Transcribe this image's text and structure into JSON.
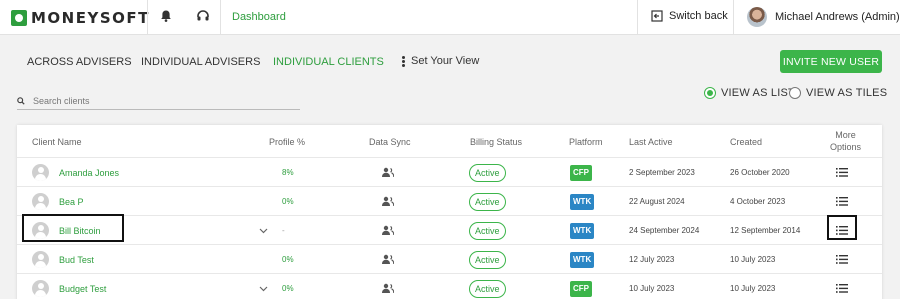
{
  "topbar": {
    "logo_text": "MONEYSOFT",
    "bell_icon": "bell-icon",
    "support_icon": "headset-icon",
    "dashboard_link": "Dashboard",
    "switch_back": "Switch back",
    "user_name": "Michael Andrews (Admin)"
  },
  "nav": {
    "items": [
      "ACROSS ADVISERS",
      "INDIVIDUAL ADVISERS",
      "INDIVIDUAL CLIENTS"
    ],
    "active": "INDIVIDUAL CLIENTS",
    "set_view": "Set Your View",
    "invite_button": "INVITE NEW USER"
  },
  "search": {
    "placeholder": "Search clients",
    "value": ""
  },
  "view": {
    "list_label": "VIEW AS LIST",
    "tiles_label": "VIEW AS TILES",
    "selected": "list"
  },
  "table": {
    "headers": {
      "client_name": "Client Name",
      "profile": "Profile %",
      "data_sync": "Data Sync",
      "billing": "Billing Status",
      "platform": "Platform",
      "last_active": "Last Active",
      "created": "Created",
      "more_line1": "More",
      "more_line2": "Options"
    },
    "rows": [
      {
        "name": "Amanda Jones",
        "profile": "8%",
        "billing": "Active",
        "platform": "CFP",
        "last_active": "2 September 2023",
        "created": "26 October 2020",
        "expand": false
      },
      {
        "name": "Bea P",
        "profile": "0%",
        "billing": "Active",
        "platform": "WTK",
        "last_active": "22 August 2024",
        "created": "4 October 2023",
        "expand": false
      },
      {
        "name": "Bill Bitcoin",
        "profile": "-",
        "billing": "Active",
        "platform": "WTK",
        "last_active": "24 September 2024",
        "created": "12 September 2014",
        "expand": true
      },
      {
        "name": "Bud Test",
        "profile": "0%",
        "billing": "Active",
        "platform": "WTK",
        "last_active": "12 July 2023",
        "created": "10 July 2023",
        "expand": false
      },
      {
        "name": "Budget Test",
        "profile": "0%",
        "billing": "Active",
        "platform": "CFP",
        "last_active": "10 July 2023",
        "created": "10 July 2023",
        "expand": true
      }
    ]
  },
  "colors": {
    "accent": "#3cb54a",
    "cfp": "#3cb54a",
    "wtk": "#2b86c5",
    "link": "#2e9e3e"
  }
}
